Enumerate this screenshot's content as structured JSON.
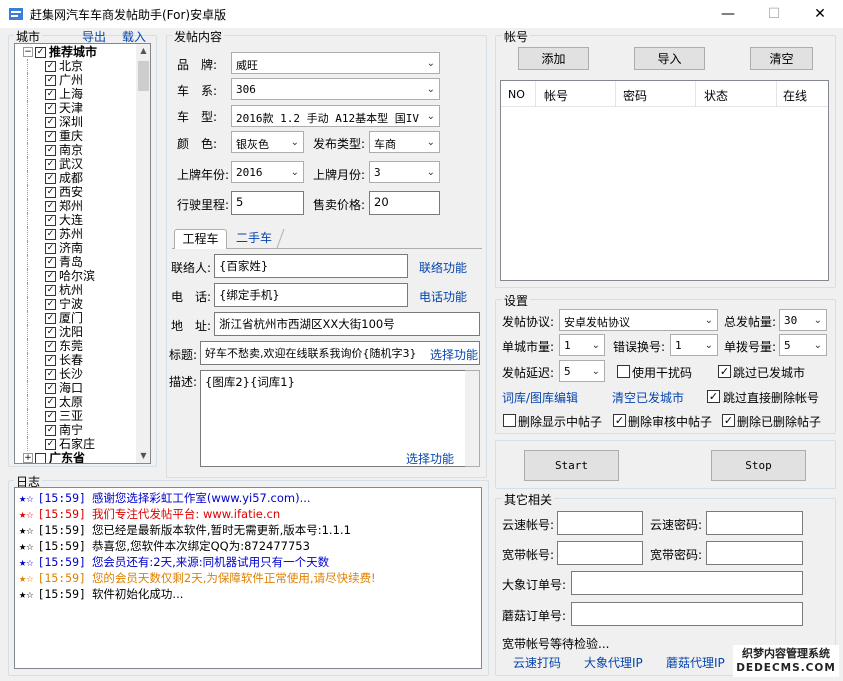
{
  "window": {
    "title": "赶集网汽车车商发帖助手(For)安卓版",
    "minimize": "—",
    "maximize": "☐",
    "close": "✕"
  },
  "city": {
    "title": "城市",
    "export": "导出",
    "import": "载入",
    "group1": "推荐城市",
    "cities": [
      "北京",
      "广州",
      "上海",
      "天津",
      "深圳",
      "重庆",
      "南京",
      "武汉",
      "成都",
      "西安",
      "郑州",
      "大连",
      "苏州",
      "济南",
      "青岛",
      "哈尔滨",
      "杭州",
      "宁波",
      "厦门",
      "沈阳",
      "东莞",
      "长春",
      "长沙",
      "海口",
      "太原",
      "三亚",
      "南宁",
      "石家庄"
    ],
    "group2": "广东省"
  },
  "post": {
    "title": "发帖内容",
    "brand_label": "品　牌:",
    "brand": "威旺",
    "series_label": "车　系:",
    "series": "306",
    "model_label": "车　型:",
    "model": "2016款 1.2 手动 A12基本型 国IV",
    "color_label": "颜　色:",
    "color": "银灰色",
    "type_label": "发布类型:",
    "type": "车商",
    "year_label": "上牌年份:",
    "year": "2016",
    "month_label": "上牌月份:",
    "month": "3",
    "mileage_label": "行驶里程:",
    "mileage": "5",
    "price_label": "售卖价格:",
    "price": "20",
    "tab1": "工程车",
    "tab2": "二手车",
    "contact_label": "联络人:",
    "contact": "{百家姓}",
    "contact_link": "联络功能",
    "phone_label": "电　话:",
    "phone": "{绑定手机}",
    "phone_link": "电话功能",
    "addr_label": "地　址:",
    "addr": "浙江省杭州市西湖区XX大街100号",
    "subject_label": "标题:",
    "subject": "好车不愁卖,欢迎在线联系我询价{随机字3}",
    "subject_link": "选择功能",
    "desc_label": "描述:",
    "desc": "{图库2}{词库1}",
    "desc_link": "选择功能"
  },
  "account": {
    "title": "帐号",
    "add": "添加",
    "import": "导入",
    "clear": "清空",
    "columns": [
      "NO",
      "帐号",
      "密码",
      "状态",
      "在线"
    ]
  },
  "settings": {
    "title": "设置",
    "protocol_label": "发帖协议:",
    "protocol": "安卓发帖协议",
    "total_label": "总发帖量:",
    "total": "30",
    "city_label": "单城市量:",
    "city": "1",
    "err_label": "错误换号:",
    "err": "1",
    "dial_label": "单拨号量:",
    "dial": "5",
    "delay_label": "发帖延迟:",
    "delay": "5",
    "interfere": "使用干扰码",
    "skip_city": "跳过已发城市",
    "lib_link": "词库/图库编辑",
    "clear_link": "清空已发城市",
    "skip_delete": "跳过直接删除帐号",
    "del_show": "删除显示中帖子",
    "del_review": "删除审核中帖子",
    "del_deleted": "删除已删除帖子",
    "start": "Start",
    "stop": "Stop"
  },
  "other": {
    "title": "其它相关",
    "yun_acc": "云速帐号:",
    "yun_pwd": "云速密码:",
    "bb_acc": "宽带帐号:",
    "bb_pwd": "宽带密码:",
    "dx_order": "大象订单号:",
    "mg_order": "蘑菇订单号:",
    "waiting": "宽带帐号等待检验...",
    "link1": "云速打码",
    "link2": "大象代理IP",
    "link3": "蘑菇代理IP"
  },
  "log": {
    "title": "日志",
    "lines": [
      {
        "time": "[15:59]",
        "text": "感谢您选择彩虹工作室(www.yi57.com)...",
        "color": "#0000cc",
        "star": "#0000cc"
      },
      {
        "time": "[15:59]",
        "text": "我们专注代发帖平台: www.ifatie.cn",
        "color": "#e00000",
        "star": "#e00000"
      },
      {
        "time": "[15:59]",
        "text": "您已经是最新版本软件,暂时无需更新,版本号:1.1.1",
        "color": "#000000",
        "star": "#000000"
      },
      {
        "time": "[15:59]",
        "text": "恭喜您,您软件本次绑定QQ为:872477753",
        "color": "#000000",
        "star": "#000000"
      },
      {
        "time": "[15:59]",
        "text": "您会员还有:2天,来源:同机器试用只有一个天数",
        "color": "#0000cc",
        "star": "#0000cc"
      },
      {
        "time": "[15:59]",
        "text": "您的会员天数仅剩2天,为保障软件正常使用,请尽快续费!",
        "color": "#e08000",
        "star": "#e08000"
      },
      {
        "time": "[15:59]",
        "text": "软件初始化成功...",
        "color": "#000000",
        "star": "#000000"
      }
    ]
  },
  "watermark": {
    "line1": "织梦内容管理系统",
    "line2": "DEDECMS.COM"
  }
}
